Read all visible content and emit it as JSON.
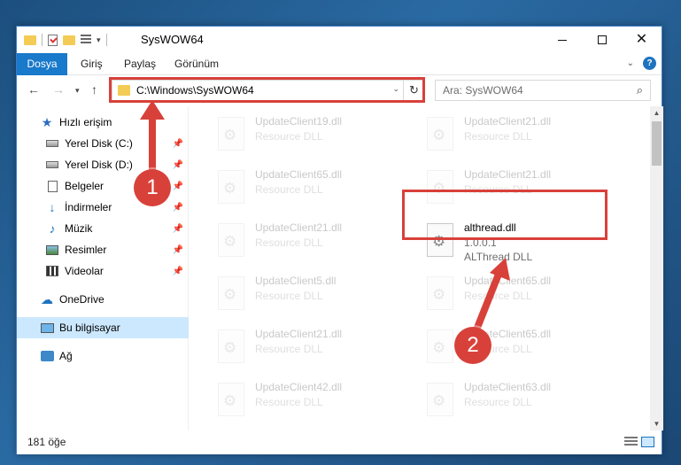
{
  "window": {
    "title": "SysWOW64",
    "buttons": {
      "minimize": "—",
      "maximize": "☐",
      "close": "✕"
    }
  },
  "ribbon": {
    "tabs": [
      "Dosya",
      "Giriş",
      "Paylaş",
      "Görünüm"
    ],
    "help": "?"
  },
  "navbar": {
    "address": "C:\\Windows\\SysWOW64",
    "search_placeholder": "Ara: SysWOW64"
  },
  "sidebar": {
    "items": [
      {
        "label": "Hızlı erişim",
        "icon": "star-icon",
        "pinned": false
      },
      {
        "label": "Yerel Disk (C:)",
        "icon": "disk-icon",
        "pinned": true
      },
      {
        "label": "Yerel Disk (D:)",
        "icon": "disk-icon",
        "pinned": true
      },
      {
        "label": "Belgeler",
        "icon": "documents-icon",
        "pinned": true
      },
      {
        "label": "İndirmeler",
        "icon": "download-icon",
        "pinned": true
      },
      {
        "label": "Müzik",
        "icon": "music-icon",
        "pinned": true
      },
      {
        "label": "Resimler",
        "icon": "pictures-icon",
        "pinned": true
      },
      {
        "label": "Videolar",
        "icon": "videos-icon",
        "pinned": true
      },
      {
        "label": "OneDrive",
        "icon": "onedrive-icon",
        "pinned": false
      },
      {
        "label": "Bu bilgisayar",
        "icon": "this-pc-icon",
        "pinned": false,
        "selected": true
      },
      {
        "label": "Ağ",
        "icon": "network-icon",
        "pinned": false
      }
    ]
  },
  "files": [
    {
      "name": "UpdateClient19.dll",
      "line2": "Resource DLL",
      "line3": "",
      "faded": true
    },
    {
      "name": "UpdateClient21.dll",
      "line2": "Resource DLL",
      "line3": "",
      "faded": true
    },
    {
      "name": "UpdateClient65.dll",
      "line2": "Resource DLL",
      "line3": "",
      "faded": true
    },
    {
      "name": "UpdateClient21.dll",
      "line2": "Resource DLL",
      "line3": "",
      "faded": true
    },
    {
      "name": "UpdateClient21.dll",
      "line2": "Resource DLL",
      "line3": "",
      "faded": true
    },
    {
      "name": "althread.dll",
      "line2": "1.0.0.1",
      "line3": "ALThread DLL",
      "faded": false
    },
    {
      "name": "UpdateClient5.dll",
      "line2": "Resource DLL",
      "line3": "",
      "faded": true
    },
    {
      "name": "UpdateClient65.dll",
      "line2": "Resource DLL",
      "line3": "",
      "faded": true
    },
    {
      "name": "UpdateClient21.dll",
      "line2": "Resource DLL",
      "line3": "",
      "faded": true
    },
    {
      "name": "UpdateClient65.dll",
      "line2": "Resource DLL",
      "line3": "",
      "faded": true
    },
    {
      "name": "UpdateClient42.dll",
      "line2": "Resource DLL",
      "line3": "",
      "faded": true
    },
    {
      "name": "UpdateClient63.dll",
      "line2": "Resource DLL",
      "line3": "",
      "faded": true
    }
  ],
  "status": {
    "item_count": "181 öğe"
  },
  "annotations": {
    "step1": "1",
    "step2": "2",
    "color": "#d8413a"
  }
}
